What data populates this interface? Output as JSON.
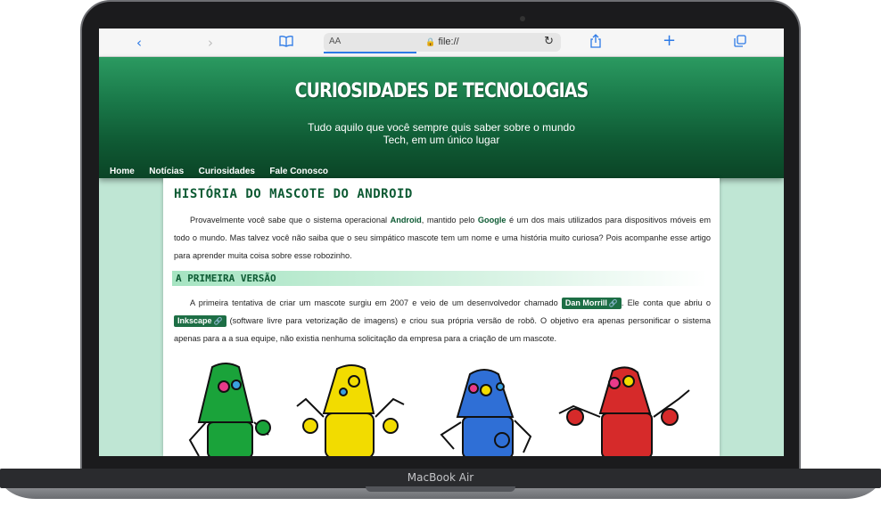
{
  "device": {
    "label": "MacBook Air"
  },
  "browser": {
    "back_icon": "chevron-left-icon",
    "forward_icon": "chevron-right-icon",
    "bookmarks_icon": "book-icon",
    "text_size": "AA",
    "url": "file://",
    "reload_icon": "reload-icon",
    "share_icon": "share-icon",
    "new_tab_icon": "plus-icon",
    "tabs_icon": "tabs-icon"
  },
  "header": {
    "title": "CURIOSIDADES DE TECNOLOGIAS",
    "subtitle_line1": "Tudo aquilo que você sempre quis saber sobre o mundo",
    "subtitle_line2": "Tech, em um único lugar"
  },
  "nav": {
    "items": [
      "Home",
      "Notícias",
      "Curiosidades",
      "Fale Conosco"
    ]
  },
  "article": {
    "title": "HISTÓRIA DO MASCOTE DO ANDROID",
    "p1_before_android": "Provavelmente você sabe que o sistema operacional ",
    "android": "Android",
    "p1_mid": ", mantido pelo ",
    "google": "Google",
    "p1_after": " é um dos mais utilizados para dispositivos móveis em todo o mundo. Mas talvez você não saiba que o seu simpático mascote tem um nome e uma história muito curiosa? Pois acompanhe esse artigo para aprender muita coisa sobre esse robozinho.",
    "section_title": "A PRIMEIRA VERSÃO",
    "p2_before": "A primeira tentativa de criar um mascote surgiu em 2007 e veio de um desenvolvedor chamado ",
    "link1": "Dan Morrill",
    "p2_mid": ". Ele conta que abriu o ",
    "link2": "Inkscape",
    "p2_after": " (software livre para vetorização de imagens) e criou sua própria versão de robô. O objetivo era apenas personificar o sistema apenas para a a sua equipe, não existia nenhuma solicitação da empresa para a criação de um mascote.",
    "link_icon": "external-link-icon",
    "robot_colors": [
      "#1aa33a",
      "#f2dc00",
      "#2f6fd6",
      "#d62a2a"
    ]
  }
}
